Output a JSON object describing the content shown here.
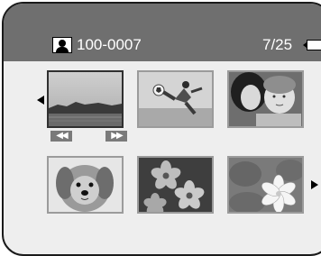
{
  "header": {
    "folder_file": "100-0007",
    "count": "7/25"
  },
  "icons": {
    "person": "person-icon",
    "battery": "battery-icon",
    "prev": "arrow-left-icon",
    "next": "arrow-right-icon",
    "rewind": "rewind-icon",
    "fast_forward": "fast-forward-icon"
  },
  "controls": {
    "rewind_label": "◀◀",
    "fast_forward_label": "▶▶"
  },
  "thumbnails": [
    {
      "content": "lake-landscape-video",
      "selected": true
    },
    {
      "content": "soccer-kick"
    },
    {
      "content": "woman-with-baby"
    },
    {
      "content": "dog-portrait"
    },
    {
      "content": "pink-flowers"
    },
    {
      "content": "white-lily-leaves"
    }
  ],
  "colors": {
    "screen_bg": "#eeeeee",
    "titlebar": "#6f6f6f",
    "thumb_border": "#9b9b9b",
    "selected_border": "#303030"
  }
}
